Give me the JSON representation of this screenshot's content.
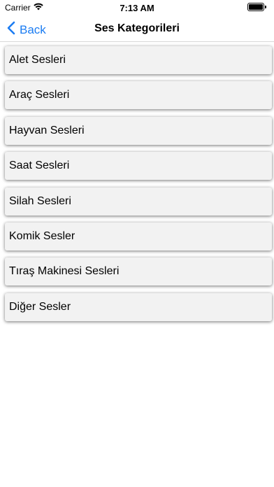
{
  "status_bar": {
    "carrier": "Carrier",
    "time": "7:13 AM",
    "wifi_icon": "wifi-icon",
    "battery_icon": "battery-icon",
    "battery_level": 1.0
  },
  "nav": {
    "back_label": "Back",
    "title": "Ses Kategorileri",
    "accent_color": "#1b7cf2"
  },
  "categories": [
    "Alet Sesleri",
    "Araç Sesleri",
    "Hayvan Sesleri",
    "Saat Sesleri",
    "Silah Sesleri",
    "Komik Sesler",
    "Tıraş Makinesi Sesleri",
    "Diğer Sesler"
  ]
}
